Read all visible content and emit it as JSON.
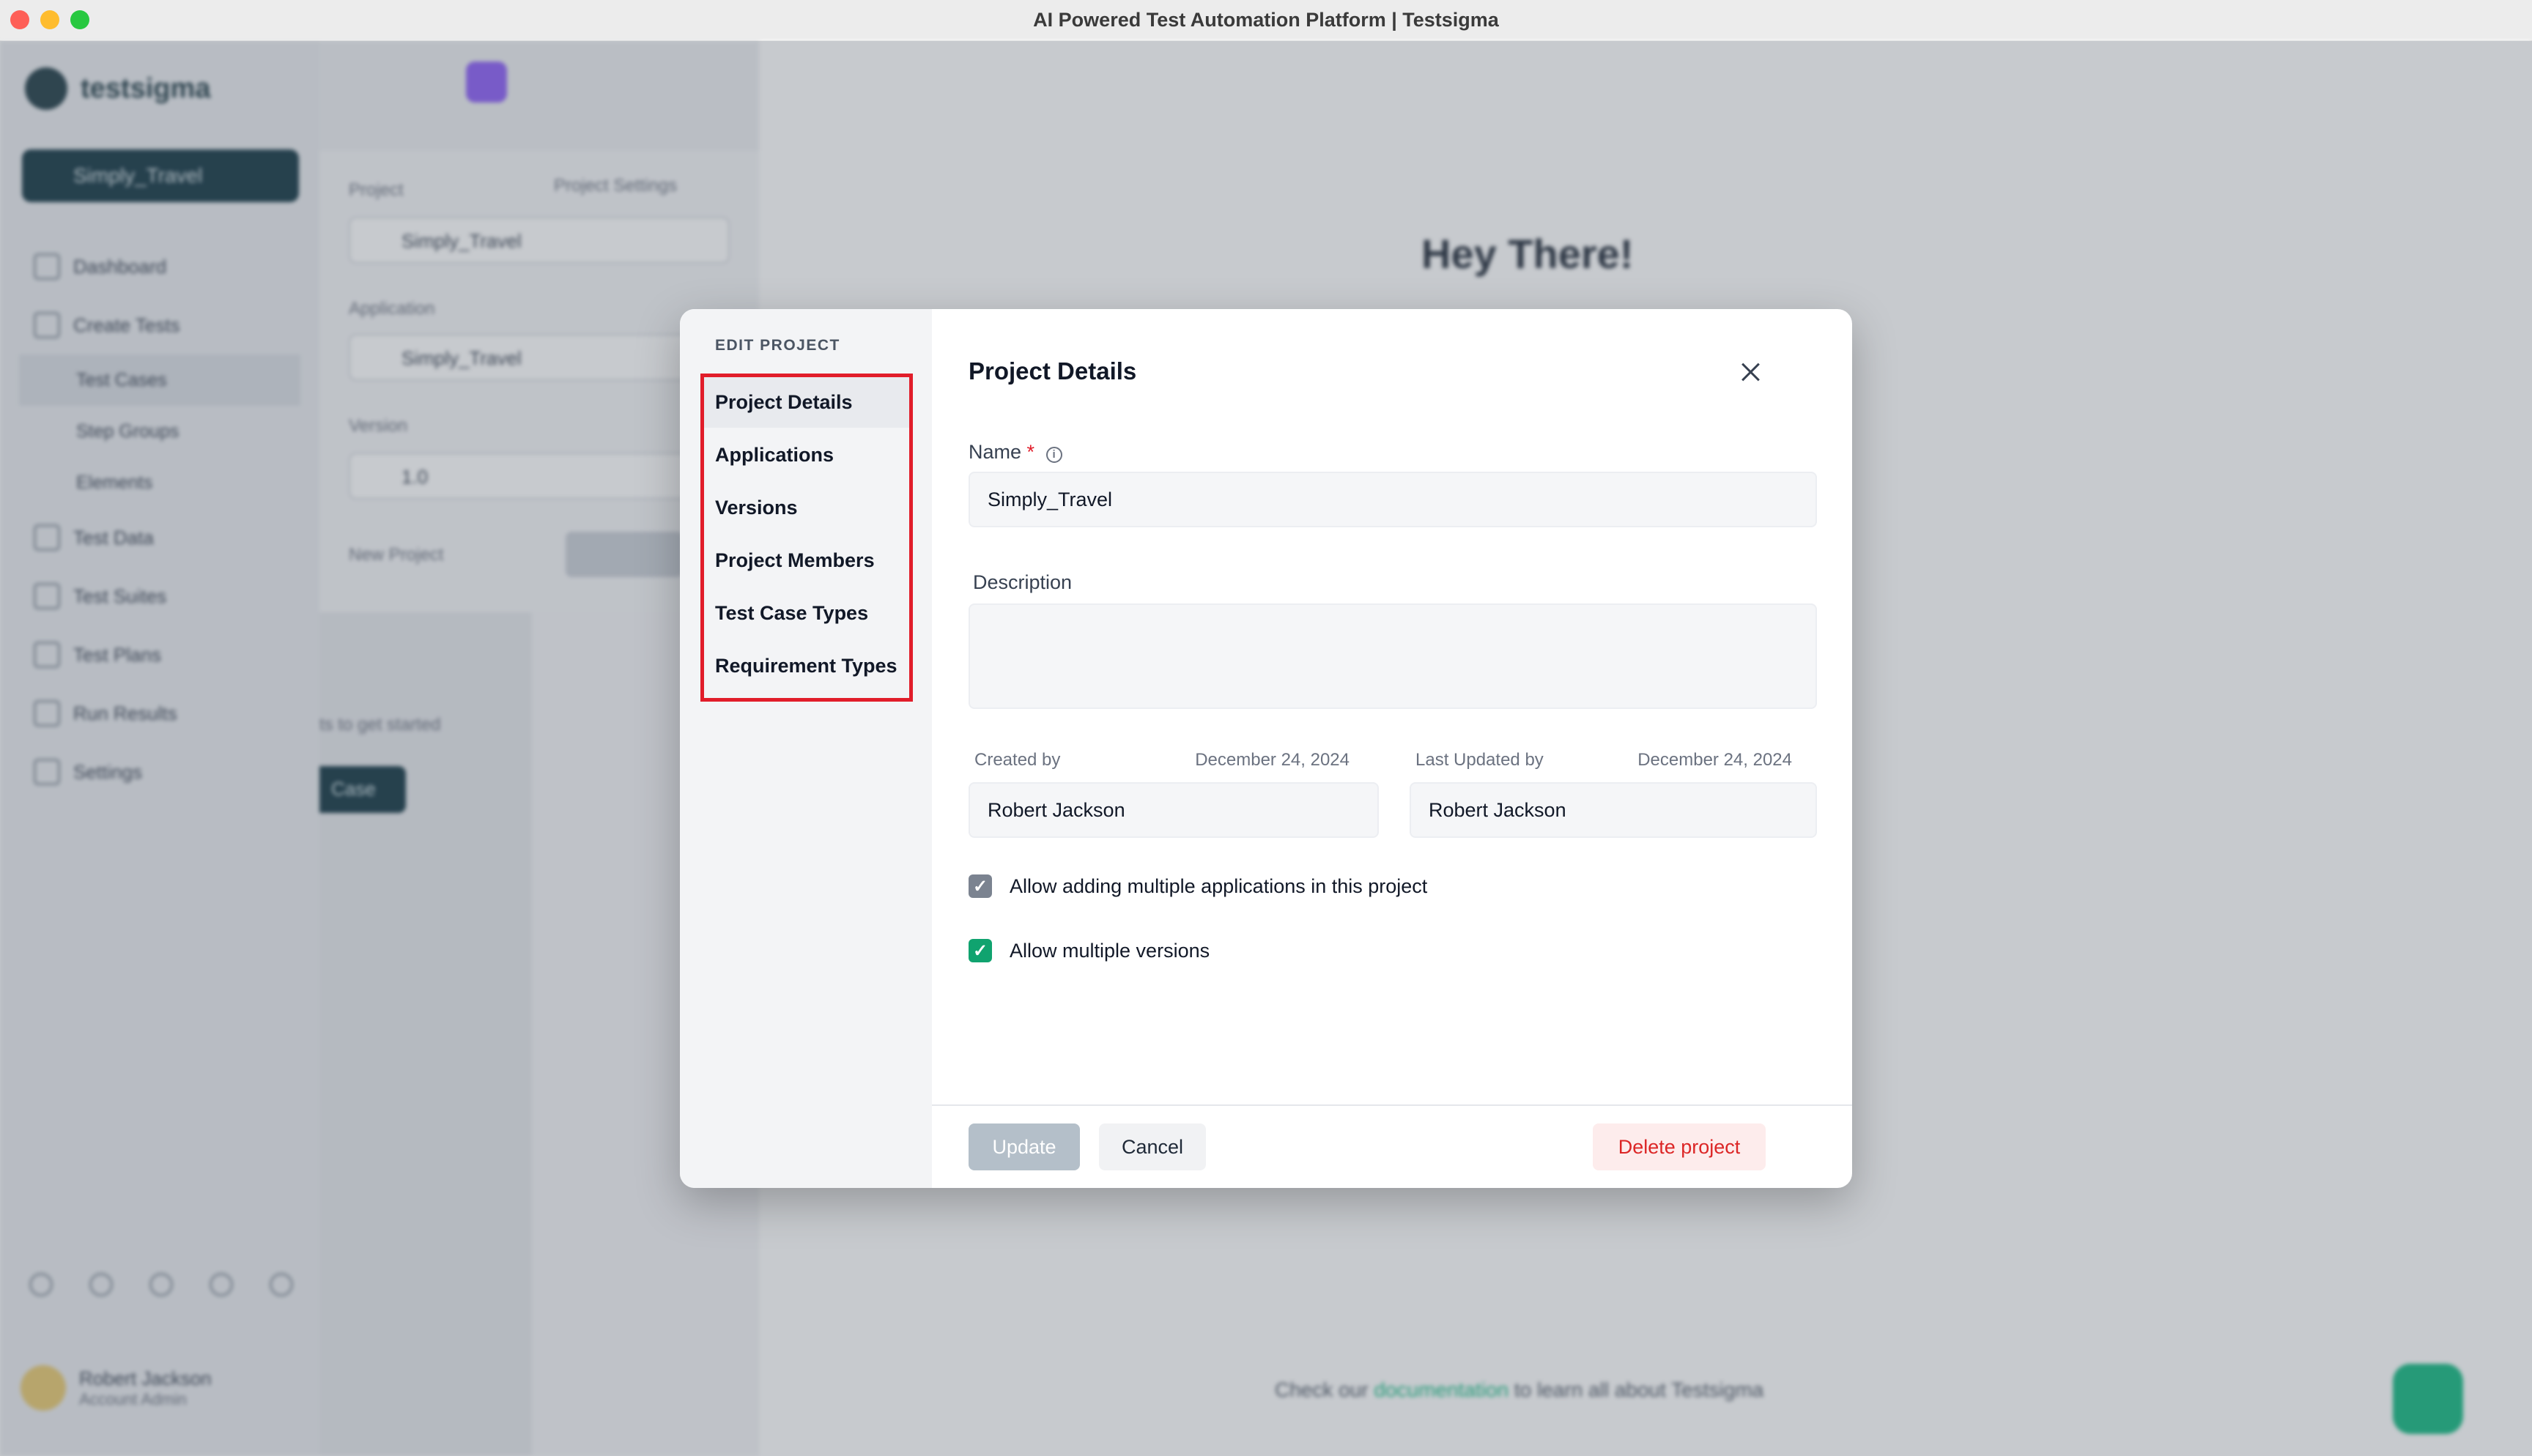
{
  "window": {
    "title": "AI Powered Test Automation Platform | Testsigma"
  },
  "background": {
    "logo_text": "testsigma",
    "project_pill": "Simply_Travel",
    "nav": [
      "Dashboard",
      "Create Tests",
      "Test Cases",
      "Step Groups",
      "Elements",
      "Test Data",
      "Test Suites",
      "Test Plans",
      "Run Results",
      "Settings"
    ],
    "user_name": "Robert Jackson",
    "user_role": "Account Admin",
    "project_label": "Project",
    "project_settings": "Project Settings",
    "project_value": "Simply_Travel",
    "application_label": "Application",
    "application_value": "Simply_Travel",
    "version_label": "Version",
    "version_value": "1.0",
    "new_project": "New Project",
    "get_started": "ts to get started",
    "case_button": "Case",
    "greeting": "Hey There!",
    "doc_prefix": "Check our ",
    "doc_link": "documentation",
    "doc_suffix": " to learn all about Testsigma"
  },
  "modal": {
    "section_label": "EDIT PROJECT",
    "tabs": [
      "Project Details",
      "Applications",
      "Versions",
      "Project Members",
      "Test Case Types",
      "Requirement Types"
    ],
    "active_tab": "Project Details",
    "title": "Project Details",
    "name_label": "Name",
    "required_mark": "*",
    "name_value": "Simply_Travel",
    "description_label": "Description",
    "description_value": "",
    "created_by_label": "Created by",
    "created_date": "December 24, 2024",
    "created_by_value": "Robert Jackson",
    "updated_by_label": "Last Updated by",
    "updated_date": "December 24, 2024",
    "updated_by_value": "Robert Jackson",
    "checkbox_multi_apps": "Allow adding multiple applications in this project",
    "checkbox_multi_versions": "Allow multiple versions",
    "update_button": "Update",
    "cancel_button": "Cancel",
    "delete_button": "Delete project"
  },
  "colors": {
    "highlight_border": "#e11d2a",
    "checkbox_green": "#10a36f",
    "delete_text": "#dc2626"
  }
}
